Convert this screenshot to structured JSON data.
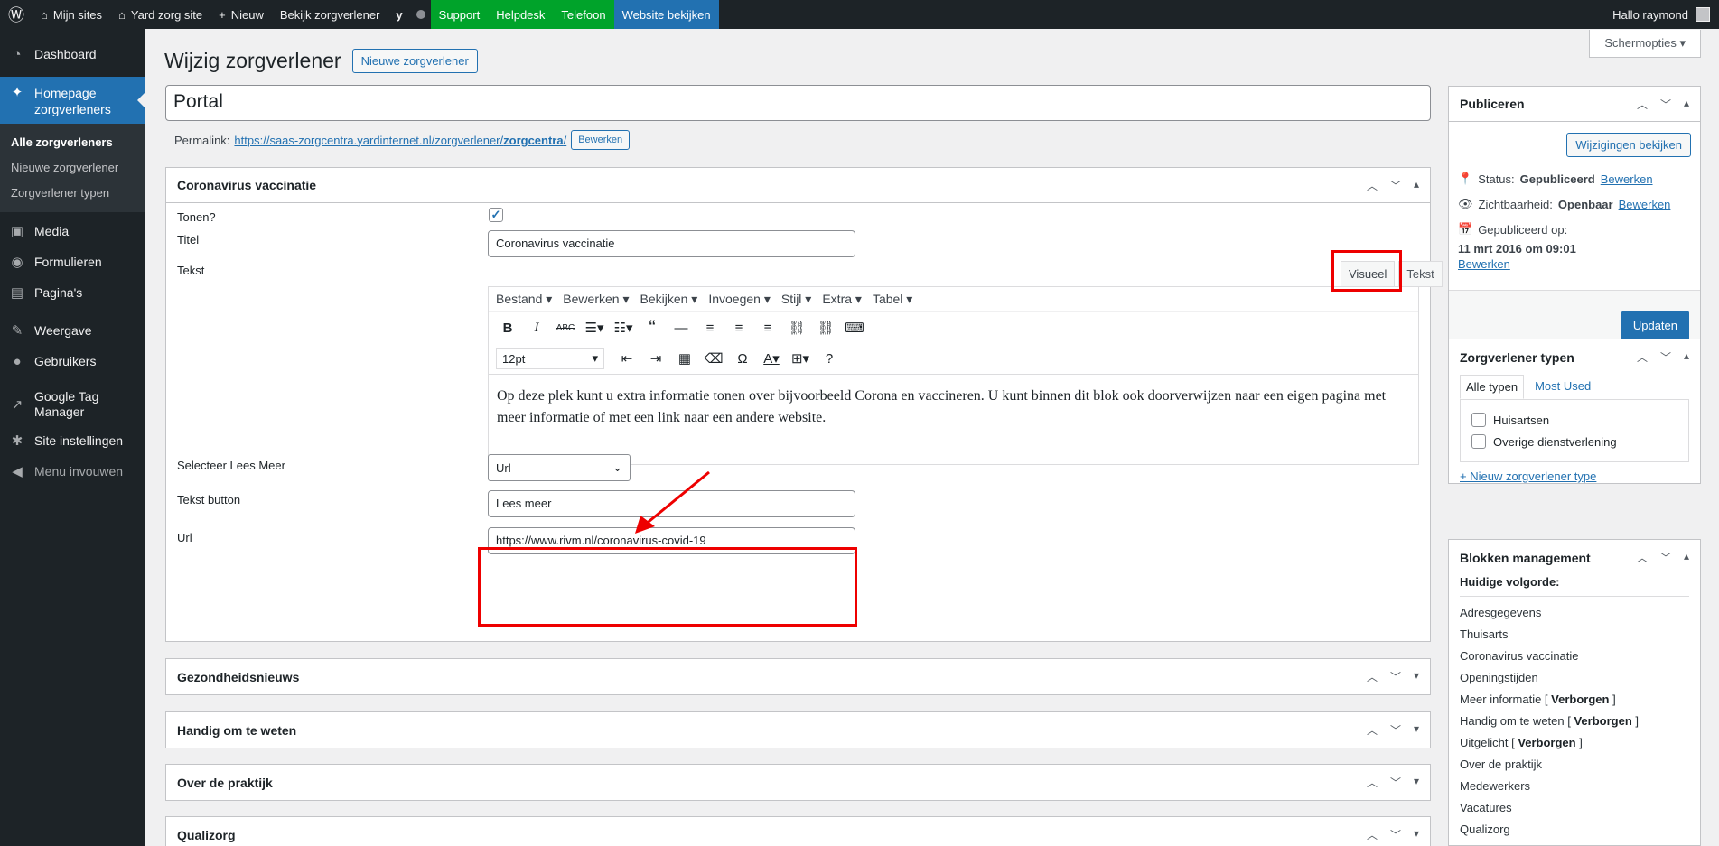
{
  "adminbar": {
    "items": [
      "Mijn sites",
      "Yard zorg site",
      "Nieuw",
      "Bekijk zorgverlener"
    ],
    "green": [
      "Support",
      "Helpdesk",
      "Telefoon"
    ],
    "blue": "Website bekijken",
    "greeting": "Hallo raymond"
  },
  "sidebar": {
    "dashboard": "Dashboard",
    "active": "Homepage zorgverleners",
    "sub": [
      "Alle zorgverleners",
      "Nieuwe zorgverlener",
      "Zorgverlener typen"
    ],
    "items": [
      "Media",
      "Formulieren",
      "Pagina's",
      "Weergave",
      "Gebruikers",
      "Google Tag Manager",
      "Site instellingen",
      "Menu invouwen"
    ]
  },
  "screen_options": "Schermopties",
  "page": {
    "title": "Wijzig zorgverlener",
    "new_button": "Nieuwe zorgverlener",
    "post_title": "Portal",
    "permalink_label": "Permalink:",
    "permalink_url": "https://saas-zorgcentra.yardinternet.nl/zorgverlener/",
    "permalink_slug": "zorgcentra",
    "permalink_tail": "/",
    "permalink_edit": "Bewerken"
  },
  "corona_box": {
    "title": "Coronavirus vaccinatie",
    "show_label": "Tonen?",
    "title_label": "Titel",
    "title_value": "Coronavirus vaccinatie",
    "text_label": "Tekst",
    "tab_visual": "Visueel",
    "tab_text": "Tekst",
    "menubar": [
      "Bestand",
      "Bewerken",
      "Bekijken",
      "Invoegen",
      "Stijl",
      "Extra",
      "Tabel"
    ],
    "font_size": "12pt",
    "body": "Op deze plek kunt u extra informatie tonen over bijvoorbeeld Corona en vaccineren. U kunt binnen dit blok ook doorverwijzen naar een eigen pagina met meer informatie of met een link naar een andere website.",
    "readmore_label": "Selecteer Lees Meer",
    "readmore_value": "Url",
    "button_label": "Tekst button",
    "button_value": "Lees meer",
    "url_label": "Url",
    "url_value": "https://www.rivm.nl/coronavirus-covid-19"
  },
  "collapsed_boxes": [
    "Gezondheidsnieuws",
    "Handig om te weten",
    "Over de praktijk",
    "Qualizorg"
  ],
  "publish": {
    "title": "Publiceren",
    "preview": "Wijzigingen bekijken",
    "status_label": "Status:",
    "status_value": "Gepubliceerd",
    "visibility_label": "Zichtbaarheid:",
    "visibility_value": "Openbaar",
    "published_label": "Gepubliceerd op:",
    "published_value": "11 mrt 2016 om 09:01",
    "edit": "Bewerken",
    "update": "Updaten"
  },
  "types": {
    "title": "Zorgverlener typen",
    "tab_all": "Alle typen",
    "tab_used": "Most Used",
    "options": [
      "Huisartsen",
      "Overige dienstverlening"
    ],
    "add": "+ Nieuw zorgverlener type"
  },
  "blocks": {
    "title": "Blokken management",
    "order_label": "Huidige volgorde:",
    "list": [
      "Adresgegevens",
      "Thuisarts",
      "Coronavirus vaccinatie",
      "Openingstijden",
      "Meer informatie",
      "Handig om te weten",
      "Uitgelicht",
      "Over de praktijk",
      "Medewerkers",
      "Vacatures",
      "Qualizorg"
    ],
    "hidden_tag": "Verborgen"
  }
}
